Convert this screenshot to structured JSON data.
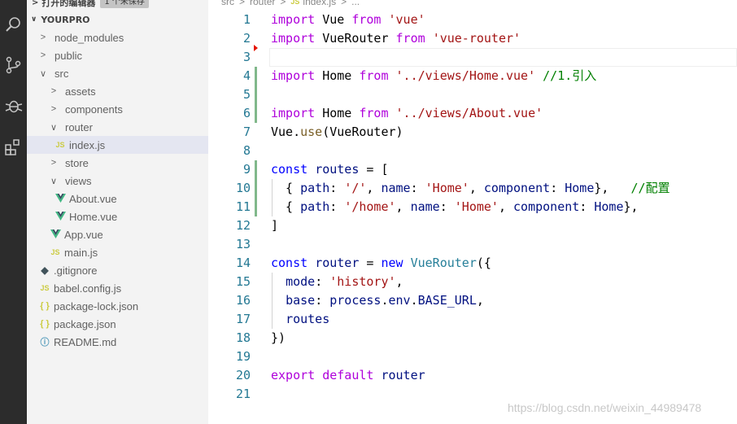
{
  "sidebar": {
    "open_editors": {
      "label": "打开的编辑器",
      "badge": "1 个未保存"
    },
    "project": "YOURPRO",
    "items": [
      {
        "label": "node_modules",
        "kind": "folder",
        "state": "collapsed",
        "depth": 0
      },
      {
        "label": "public",
        "kind": "folder",
        "state": "collapsed",
        "depth": 0
      },
      {
        "label": "src",
        "kind": "folder",
        "state": "expanded",
        "depth": 0
      },
      {
        "label": "assets",
        "kind": "folder",
        "state": "collapsed",
        "depth": 1
      },
      {
        "label": "components",
        "kind": "folder",
        "state": "collapsed",
        "depth": 1
      },
      {
        "label": "router",
        "kind": "folder",
        "state": "expanded",
        "depth": 1
      },
      {
        "label": "index.js",
        "kind": "js",
        "depth": 2,
        "active": true
      },
      {
        "label": "store",
        "kind": "folder",
        "state": "collapsed",
        "depth": 1
      },
      {
        "label": "views",
        "kind": "folder",
        "state": "expanded",
        "depth": 1
      },
      {
        "label": "About.vue",
        "kind": "vue",
        "depth": 2
      },
      {
        "label": "Home.vue",
        "kind": "vue",
        "depth": 2
      },
      {
        "label": "App.vue",
        "kind": "vue",
        "depth": 1
      },
      {
        "label": "main.js",
        "kind": "js",
        "depth": 1
      },
      {
        "label": ".gitignore",
        "kind": "git",
        "depth": 0
      },
      {
        "label": "babel.config.js",
        "kind": "js",
        "depth": 0
      },
      {
        "label": "package-lock.json",
        "kind": "json",
        "depth": 0
      },
      {
        "label": "package.json",
        "kind": "json",
        "depth": 0
      },
      {
        "label": "README.md",
        "kind": "info",
        "depth": 0
      }
    ]
  },
  "breadcrumb": {
    "parts": [
      "src",
      "router",
      "index.js",
      "..."
    ]
  },
  "icons": {
    "activity": [
      "search-icon",
      "source-control-icon",
      "debug-icon",
      "extensions-icon"
    ],
    "js_badge": "JS",
    "json_badge": "{ }",
    "git_badge": "◆",
    "info_badge": "ⓘ"
  },
  "colors": {
    "keyword": "#af00db",
    "declaration": "#0000ff",
    "string": "#a31515",
    "comment": "#008000",
    "variable": "#001080",
    "type": "#267f99",
    "function": "#795e26",
    "line_number": "#237893",
    "modified_bar": "#81b88b",
    "vue_icon": "#41b883",
    "js_icon": "#cbcb41"
  },
  "editor": {
    "current_line": 3,
    "lines": [
      [
        {
          "t": "import",
          "c": "kw"
        },
        {
          "t": " Vue ",
          "c": "plain"
        },
        {
          "t": "from",
          "c": "kw"
        },
        {
          "t": " ",
          "c": "plain"
        },
        {
          "t": "'vue'",
          "c": "str"
        }
      ],
      [
        {
          "t": "import",
          "c": "kw"
        },
        {
          "t": " VueRouter ",
          "c": "plain"
        },
        {
          "t": "from",
          "c": "kw"
        },
        {
          "t": " ",
          "c": "plain"
        },
        {
          "t": "'vue-router'",
          "c": "str"
        }
      ],
      [],
      [
        {
          "t": "import",
          "c": "kw"
        },
        {
          "t": " Home ",
          "c": "plain"
        },
        {
          "t": "from",
          "c": "kw"
        },
        {
          "t": " ",
          "c": "plain"
        },
        {
          "t": "'../views/Home.vue'",
          "c": "str"
        },
        {
          "t": " ",
          "c": "plain"
        },
        {
          "t": "//1.引入",
          "c": "cmt"
        }
      ],
      [],
      [
        {
          "t": "import",
          "c": "kw"
        },
        {
          "t": " Home ",
          "c": "plain"
        },
        {
          "t": "from",
          "c": "kw"
        },
        {
          "t": " ",
          "c": "plain"
        },
        {
          "t": "'../views/About.vue'",
          "c": "str"
        }
      ],
      [
        {
          "t": "Vue",
          "c": "plain"
        },
        {
          "t": ".",
          "c": "plain"
        },
        {
          "t": "use",
          "c": "fn"
        },
        {
          "t": "(VueRouter)",
          "c": "plain"
        }
      ],
      [],
      [
        {
          "t": "const",
          "c": "decl"
        },
        {
          "t": " ",
          "c": "plain"
        },
        {
          "t": "routes",
          "c": "var"
        },
        {
          "t": " = [",
          "c": "plain"
        }
      ],
      [
        {
          "t": "  { ",
          "c": "plain"
        },
        {
          "t": "path",
          "c": "var"
        },
        {
          "t": ": ",
          "c": "plain"
        },
        {
          "t": "'/'",
          "c": "str"
        },
        {
          "t": ", ",
          "c": "plain"
        },
        {
          "t": "name",
          "c": "var"
        },
        {
          "t": ": ",
          "c": "plain"
        },
        {
          "t": "'Home'",
          "c": "str"
        },
        {
          "t": ", ",
          "c": "plain"
        },
        {
          "t": "component",
          "c": "var"
        },
        {
          "t": ": ",
          "c": "plain"
        },
        {
          "t": "Home",
          "c": "var"
        },
        {
          "t": "},   ",
          "c": "plain"
        },
        {
          "t": "//配置",
          "c": "cmt"
        }
      ],
      [
        {
          "t": "  { ",
          "c": "plain"
        },
        {
          "t": "path",
          "c": "var"
        },
        {
          "t": ": ",
          "c": "plain"
        },
        {
          "t": "'/home'",
          "c": "str"
        },
        {
          "t": ", ",
          "c": "plain"
        },
        {
          "t": "name",
          "c": "var"
        },
        {
          "t": ": ",
          "c": "plain"
        },
        {
          "t": "'Home'",
          "c": "str"
        },
        {
          "t": ", ",
          "c": "plain"
        },
        {
          "t": "component",
          "c": "var"
        },
        {
          "t": ": ",
          "c": "plain"
        },
        {
          "t": "Home",
          "c": "var"
        },
        {
          "t": "},",
          "c": "plain"
        }
      ],
      [
        {
          "t": "]",
          "c": "plain"
        }
      ],
      [],
      [
        {
          "t": "const",
          "c": "decl"
        },
        {
          "t": " ",
          "c": "plain"
        },
        {
          "t": "router",
          "c": "var"
        },
        {
          "t": " = ",
          "c": "plain"
        },
        {
          "t": "new",
          "c": "decl"
        },
        {
          "t": " ",
          "c": "plain"
        },
        {
          "t": "VueRouter",
          "c": "type"
        },
        {
          "t": "({",
          "c": "plain"
        }
      ],
      [
        {
          "t": "  ",
          "c": "plain"
        },
        {
          "t": "mode",
          "c": "var"
        },
        {
          "t": ": ",
          "c": "plain"
        },
        {
          "t": "'history'",
          "c": "str"
        },
        {
          "t": ",",
          "c": "plain"
        }
      ],
      [
        {
          "t": "  ",
          "c": "plain"
        },
        {
          "t": "base",
          "c": "var"
        },
        {
          "t": ": ",
          "c": "plain"
        },
        {
          "t": "process",
          "c": "var"
        },
        {
          "t": ".",
          "c": "plain"
        },
        {
          "t": "env",
          "c": "var"
        },
        {
          "t": ".",
          "c": "plain"
        },
        {
          "t": "BASE_URL",
          "c": "var"
        },
        {
          "t": ",",
          "c": "plain"
        }
      ],
      [
        {
          "t": "  ",
          "c": "plain"
        },
        {
          "t": "routes",
          "c": "var"
        }
      ],
      [
        {
          "t": "})",
          "c": "plain"
        }
      ],
      [],
      [
        {
          "t": "export",
          "c": "kw"
        },
        {
          "t": " ",
          "c": "plain"
        },
        {
          "t": "default",
          "c": "kw"
        },
        {
          "t": " ",
          "c": "plain"
        },
        {
          "t": "router",
          "c": "var"
        }
      ],
      []
    ]
  },
  "watermark": "https://blog.csdn.net/weixin_44989478"
}
